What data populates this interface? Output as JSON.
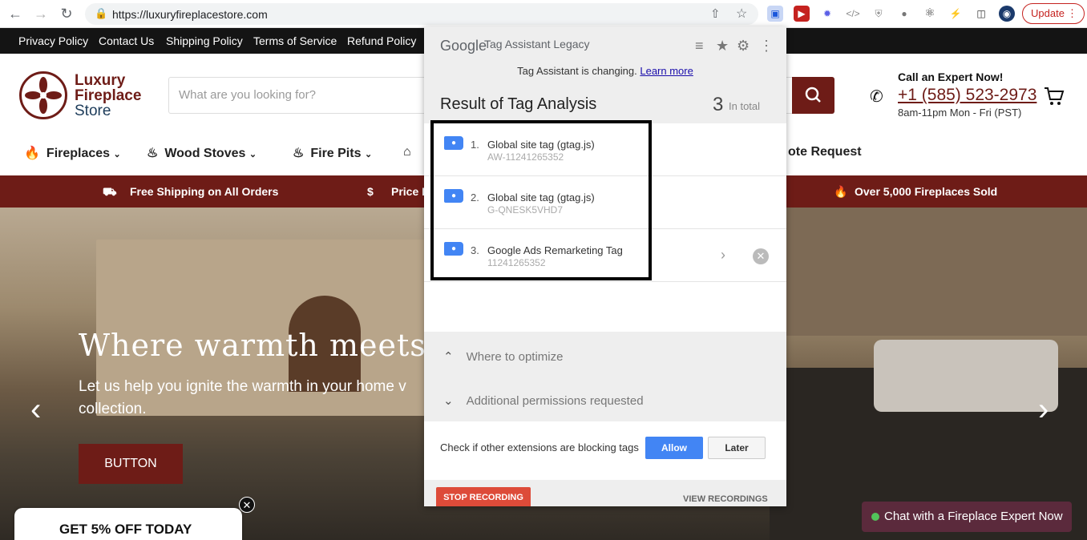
{
  "browser": {
    "url": "https://luxuryfireplacestore.com",
    "update_label": "Update"
  },
  "policy_links": [
    "Privacy Policy",
    "Contact Us",
    "Shipping Policy",
    "Terms of Service",
    "Refund Policy"
  ],
  "header": {
    "logo_line1": "Luxury",
    "logo_line2": "Fireplace",
    "logo_line3": "Store",
    "search_placeholder": "What are you looking for?",
    "call_label": "Call an Expert Now!",
    "call_number": "+1 (585) 523-2973",
    "call_hours": "8am-11pm Mon - Fri (PST)"
  },
  "nav": {
    "fireplaces": "Fireplaces",
    "wood_stoves": "Wood Stoves",
    "fire_pits": "Fire Pits",
    "quote_request": "ote Request"
  },
  "promo": {
    "shipping": "Free Shipping on All Orders",
    "price": "Price B",
    "sold": "Over 5,000 Fireplaces Sold"
  },
  "hero": {
    "title": "Where warmth meets ele",
    "subtitle": "Let us help you ignite the warmth in your home v collection.",
    "button": "BUTTON"
  },
  "offer": {
    "text": "GET 5% OFF TODAY"
  },
  "chat": {
    "label": "Chat with a Fireplace Expert Now"
  },
  "tag_assistant": {
    "brand": "Google",
    "product": "Tag Assistant Legacy",
    "notice": "Tag Assistant is changing.",
    "learn_more": "Learn more",
    "result_title": "Result of Tag Analysis",
    "count": "3",
    "in_total": "In total",
    "tags": [
      {
        "num": "1.",
        "name": "Global site tag (gtag.js)",
        "id": "AW-11241265352"
      },
      {
        "num": "2.",
        "name": "Global site tag (gtag.js)",
        "id": "G-QNESK5VHD7"
      },
      {
        "num": "3.",
        "name": "Google Ads Remarketing Tag",
        "id": "11241265352"
      }
    ],
    "where_to_optimize": "Where to optimize",
    "additional_permissions": "Additional permissions requested",
    "blocking_check": "Check if other extensions are blocking tags",
    "allow": "Allow",
    "later": "Later",
    "stop_recording": "STOP RECORDING",
    "view_recordings": "VIEW RECORDINGS"
  }
}
